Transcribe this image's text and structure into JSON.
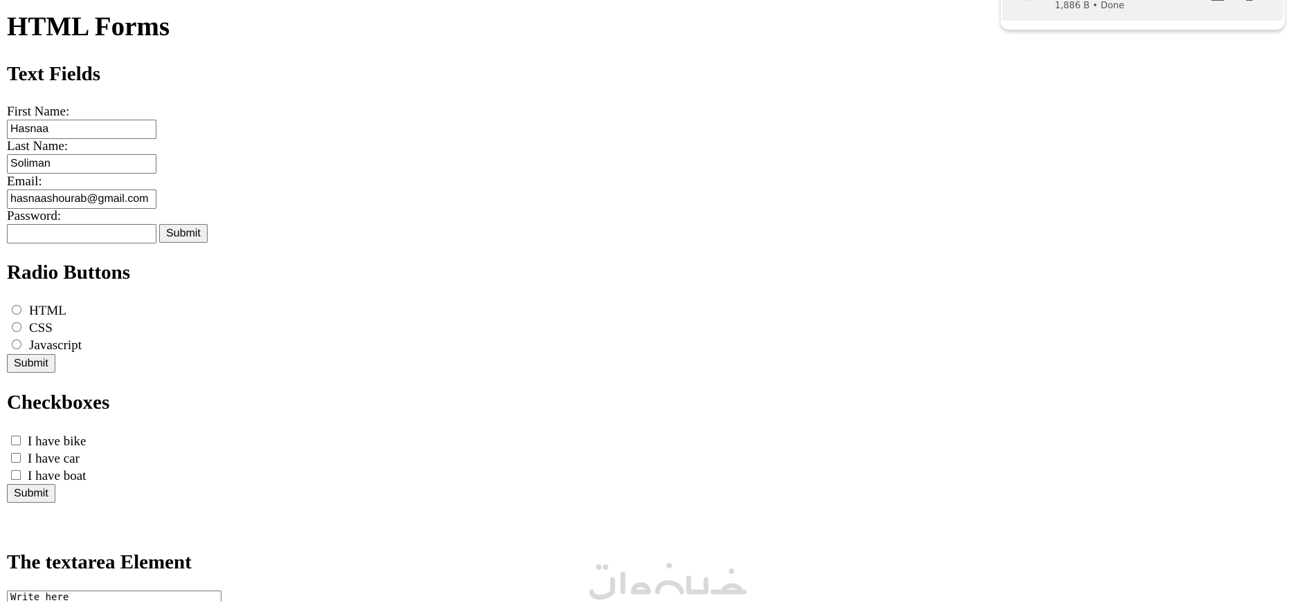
{
  "page": {
    "title": "HTML Forms"
  },
  "text_fields": {
    "heading": "Text Fields",
    "first_name_label": "First Name:",
    "first_name_value": "Hasnaa",
    "last_name_label": "Last Name:",
    "last_name_value": "Soliman",
    "email_label": "Email:",
    "email_value": "hasnaashourab@gmail.com",
    "password_label": "Password:",
    "password_value": "",
    "submit_label": "Submit"
  },
  "radio_buttons": {
    "heading": "Radio Buttons",
    "options": [
      "HTML",
      "CSS",
      "Javascript"
    ],
    "submit_label": "Submit"
  },
  "checkboxes": {
    "heading": "Checkboxes",
    "options": [
      "I have bike",
      "I have car",
      "I have boat"
    ],
    "submit_label": "Submit"
  },
  "textarea_section": {
    "heading": "The textarea Element",
    "value": "Write here"
  },
  "download_panel": {
    "status": "1,886 B • Done"
  },
  "icons": {
    "download_file_icon": "file-icon",
    "open_folder_icon": "folder-icon",
    "watermark_logo": "khamsat-logo"
  },
  "colors": {
    "input_border": "#767676",
    "button_bg": "#efefef",
    "watermark": "#d9d9d9"
  }
}
